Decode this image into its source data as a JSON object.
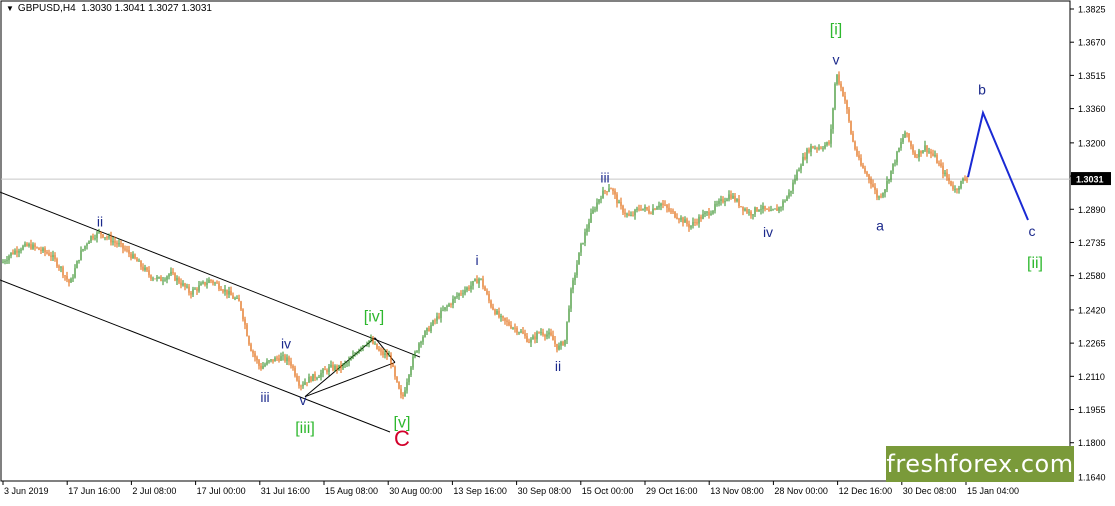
{
  "header": {
    "symbol": "GBPUSD,H4",
    "quote": "1.3030 1.3041 1.3027 1.3031"
  },
  "watermark": "freshforex.com",
  "colors": {
    "bull": "#2e8b22",
    "bear": "#e06000",
    "wave_blue": "#1c2a8c",
    "wave_green": "#2eb82e",
    "wave_red": "#d2002a",
    "projection": "#1a2ad4"
  },
  "chart_data": {
    "type": "line",
    "title": "GBPUSD,H4",
    "y_ticks": [
      "1.3825",
      "1.3670",
      "1.3515",
      "1.3360",
      "1.3200",
      "1.3045",
      "1.2890",
      "1.2735",
      "1.2580",
      "1.2420",
      "1.2265",
      "1.2110",
      "1.1955",
      "1.1800",
      "1.1640"
    ],
    "ylim": [
      1.164,
      1.3825
    ],
    "current_price": "1.3031",
    "x_ticks": [
      "3 Jun 2019",
      "17 Jun 16:00",
      "2 Jul 08:00",
      "17 Jul 00:00",
      "31 Jul 16:00",
      "15 Aug 08:00",
      "30 Aug 00:00",
      "13 Sep 16:00",
      "30 Sep 08:00",
      "15 Oct 00:00",
      "29 Oct 16:00",
      "13 Nov 08:00",
      "28 Nov 00:00",
      "12 Dec 16:00",
      "30 Dec 08:00",
      "15 Jan 04:00"
    ],
    "series": [
      {
        "values": [
          [
            0,
            1.263
          ],
          [
            10,
            1.268
          ],
          [
            20,
            1.271
          ],
          [
            30,
            1.272
          ],
          [
            40,
            1.27
          ],
          [
            50,
            1.268
          ],
          [
            60,
            1.262
          ],
          [
            70,
            1.254
          ],
          [
            80,
            1.268
          ],
          [
            90,
            1.276
          ],
          [
            100,
            1.278
          ],
          [
            110,
            1.275
          ],
          [
            120,
            1.272
          ],
          [
            130,
            1.268
          ],
          [
            140,
            1.263
          ],
          [
            150,
            1.258
          ],
          [
            160,
            1.256
          ],
          [
            170,
            1.259
          ],
          [
            180,
            1.255
          ],
          [
            190,
            1.25
          ],
          [
            200,
            1.253
          ],
          [
            210,
            1.256
          ],
          [
            220,
            1.253
          ],
          [
            230,
            1.249
          ],
          [
            240,
            1.245
          ],
          [
            250,
            1.225
          ],
          [
            260,
            1.215
          ],
          [
            270,
            1.218
          ],
          [
            280,
            1.22
          ],
          [
            290,
            1.218
          ],
          [
            300,
            1.207
          ],
          [
            310,
            1.21
          ],
          [
            320,
            1.212
          ],
          [
            330,
            1.215
          ],
          [
            340,
            1.215
          ],
          [
            350,
            1.218
          ],
          [
            360,
            1.225
          ],
          [
            370,
            1.228
          ],
          [
            380,
            1.222
          ],
          [
            390,
            1.22
          ],
          [
            395,
            1.21
          ],
          [
            402,
            1.2
          ],
          [
            410,
            1.215
          ],
          [
            420,
            1.228
          ],
          [
            430,
            1.234
          ],
          [
            440,
            1.24
          ],
          [
            450,
            1.245
          ],
          [
            460,
            1.25
          ],
          [
            470,
            1.253
          ],
          [
            480,
            1.257
          ],
          [
            490,
            1.245
          ],
          [
            500,
            1.238
          ],
          [
            510,
            1.235
          ],
          [
            520,
            1.232
          ],
          [
            530,
            1.227
          ],
          [
            540,
            1.232
          ],
          [
            550,
            1.23
          ],
          [
            558,
            1.224
          ],
          [
            565,
            1.228
          ],
          [
            570,
            1.248
          ],
          [
            580,
            1.27
          ],
          [
            590,
            1.285
          ],
          [
            600,
            1.295
          ],
          [
            610,
            1.3
          ],
          [
            620,
            1.29
          ],
          [
            630,
            1.285
          ],
          [
            640,
            1.29
          ],
          [
            650,
            1.288
          ],
          [
            660,
            1.292
          ],
          [
            670,
            1.288
          ],
          [
            680,
            1.285
          ],
          [
            690,
            1.281
          ],
          [
            700,
            1.285
          ],
          [
            710,
            1.288
          ],
          [
            720,
            1.292
          ],
          [
            730,
            1.296
          ],
          [
            740,
            1.291
          ],
          [
            750,
            1.287
          ],
          [
            760,
            1.29
          ],
          [
            770,
            1.287
          ],
          [
            780,
            1.29
          ],
          [
            790,
            1.297
          ],
          [
            800,
            1.31
          ],
          [
            810,
            1.318
          ],
          [
            820,
            1.318
          ],
          [
            830,
            1.32
          ],
          [
            836,
            1.353
          ],
          [
            845,
            1.34
          ],
          [
            852,
            1.322
          ],
          [
            860,
            1.31
          ],
          [
            870,
            1.303
          ],
          [
            878,
            1.294
          ],
          [
            885,
            1.299
          ],
          [
            895,
            1.312
          ],
          [
            905,
            1.325
          ],
          [
            915,
            1.314
          ],
          [
            925,
            1.318
          ],
          [
            935,
            1.313
          ],
          [
            945,
            1.305
          ],
          [
            955,
            1.298
          ],
          [
            962,
            1.302
          ],
          [
            968,
            1.304
          ]
        ]
      }
    ],
    "labels": [
      {
        "text": "ii",
        "x": 100,
        "y": 1.281,
        "color": "blue"
      },
      {
        "text": "iii",
        "x": 265,
        "y": 1.199,
        "color": "blue"
      },
      {
        "text": "iv",
        "x": 286,
        "y": 1.224,
        "color": "blue"
      },
      {
        "text": "v",
        "x": 303,
        "y": 1.1975,
        "color": "blue"
      },
      {
        "text": "[iii]",
        "x": 305,
        "y": 1.1845,
        "color": "green"
      },
      {
        "text": "[iv]",
        "x": 374,
        "y": 1.2365,
        "color": "green"
      },
      {
        "text": "[v]",
        "x": 402,
        "y": 1.187,
        "color": "green"
      },
      {
        "text": "C",
        "x": 402,
        "y": 1.1785,
        "color": "red"
      },
      {
        "text": "i",
        "x": 477,
        "y": 1.263,
        "color": "blue"
      },
      {
        "text": "ii",
        "x": 558,
        "y": 1.2135,
        "color": "blue"
      },
      {
        "text": "iii",
        "x": 605,
        "y": 1.3015,
        "color": "blue"
      },
      {
        "text": "iv",
        "x": 768,
        "y": 1.276,
        "color": "blue"
      },
      {
        "text": "[i]",
        "x": 836,
        "y": 1.3705,
        "color": "green"
      },
      {
        "text": "v",
        "x": 836,
        "y": 1.3565,
        "color": "blue"
      },
      {
        "text": "a",
        "x": 880,
        "y": 1.279,
        "color": "blue"
      },
      {
        "text": "b",
        "x": 982,
        "y": 1.3425,
        "color": "blue"
      },
      {
        "text": "c",
        "x": 1032,
        "y": 1.2765,
        "color": "blue"
      },
      {
        "text": "[ii]",
        "x": 1035,
        "y": 1.2615,
        "color": "green"
      }
    ],
    "projection": [
      [
        968,
        1.304
      ],
      [
        983,
        1.334
      ],
      [
        1028,
        1.284
      ]
    ],
    "channel_upper": [
      [
        0,
        1.297
      ],
      [
        420,
        1.22
      ]
    ],
    "channel_lower": [
      [
        0,
        1.256
      ],
      [
        390,
        1.185
      ]
    ],
    "triangle": [
      [
        305,
        1.2015
      ],
      [
        375,
        1.229
      ],
      [
        395,
        1.2175
      ]
    ]
  }
}
